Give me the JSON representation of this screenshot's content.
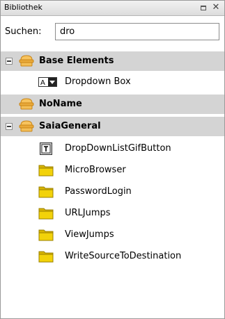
{
  "panel": {
    "title": "Bibliothek"
  },
  "search": {
    "label": "Suchen:",
    "value": "dro"
  },
  "tree": {
    "base_elements": {
      "label": "Base Elements",
      "children": [
        {
          "label": "Dropdown Box",
          "icon": "dropdown-icon"
        }
      ]
    },
    "noname": {
      "label": "NoName"
    },
    "saiageneral": {
      "label": "SaiaGeneral",
      "children": [
        {
          "label": "DropDownListGifButton",
          "icon": "textbox-icon"
        },
        {
          "label": "MicroBrowser",
          "icon": "folder-icon"
        },
        {
          "label": "PasswordLogin",
          "icon": "folder-icon"
        },
        {
          "label": "URLJumps",
          "icon": "folder-icon"
        },
        {
          "label": "ViewJumps",
          "icon": "folder-icon"
        },
        {
          "label": "WriteSourceToDestination",
          "icon": "folder-icon"
        }
      ]
    }
  },
  "colors": {
    "category_bg": "#d4d4d4",
    "folder_yellow": "#f2d20a",
    "category_icon": "#e9a93a"
  }
}
